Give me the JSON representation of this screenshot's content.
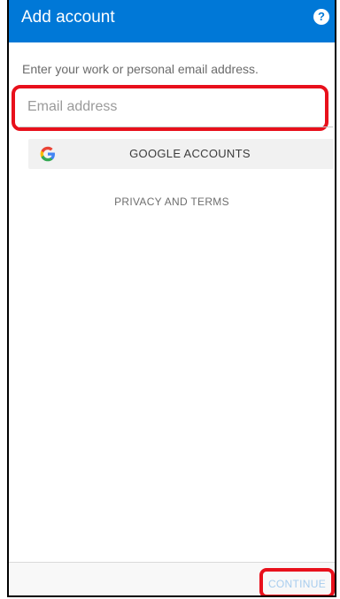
{
  "app_bar": {
    "title": "Add account",
    "help_glyph": "?",
    "color": "#0078d7"
  },
  "form": {
    "instruction": "Enter your work or personal email address.",
    "email_placeholder": "Email address",
    "email_value": ""
  },
  "google": {
    "label": "GOOGLE ACCOUNTS",
    "icon": "google-g-icon"
  },
  "privacy_link": "PRIVACY AND TERMS",
  "footer": {
    "continue_label": "CONTINUE",
    "continue_color": "#a8cdee"
  },
  "highlight_color": "#e8101b"
}
